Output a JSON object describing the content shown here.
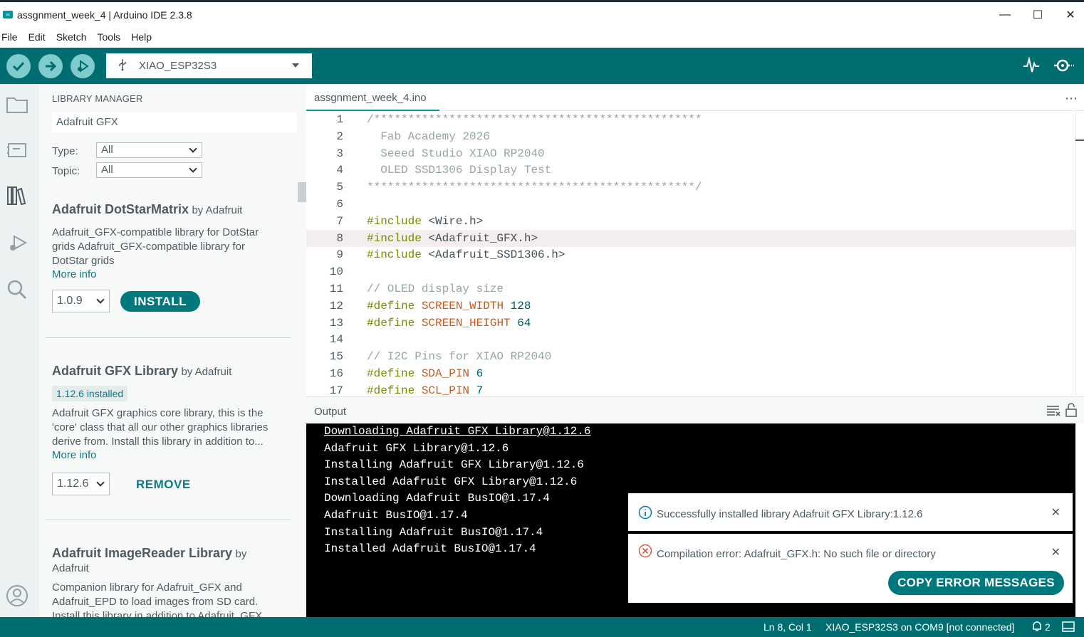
{
  "window": {
    "title": "assgnment_week_4 | Arduino IDE 2.3.8",
    "minimize": "—",
    "maximize": "☐",
    "close": "✕"
  },
  "menu": [
    "File",
    "Edit",
    "Sketch",
    "Tools",
    "Help"
  ],
  "toolbar": {
    "board": "XIAO_ESP32S3",
    "accent": "#006d70"
  },
  "library_manager": {
    "title": "LIBRARY MANAGER",
    "search_value": "Adafruit GFX",
    "type_label": "Type:",
    "type_value": "All",
    "topic_label": "Topic:",
    "topic_value": "All",
    "items": [
      {
        "name": "Adafruit DotStarMatrix",
        "by": "by Adafruit",
        "desc_lines": [
          "Adafruit_GFX-compatible library for DotStar",
          "grids Adafruit_GFX-compatible library for",
          "DotStar grids"
        ],
        "more_info": "More info",
        "version": "1.0.9",
        "action": "INSTALL"
      },
      {
        "name": "Adafruit GFX Library",
        "by": "by Adafruit",
        "installed": "1.12.6 installed",
        "desc_lines": [
          "Adafruit GFX graphics core library, this is the",
          "'core' class that all our other graphics libraries",
          "derive from. Install this library in addition to..."
        ],
        "more_info": "More info",
        "version": "1.12.6",
        "action": "REMOVE"
      },
      {
        "name": "Adafruit ImageReader Library",
        "by_inline": "by",
        "by_line2": "Adafruit",
        "desc_lines": [
          "Companion library for Adafruit_GFX and",
          "Adafruit_EPD to load images from SD card.",
          "Install this library in addition to Adafruit_GFX"
        ]
      }
    ]
  },
  "editor": {
    "tab": "assgnment_week_4.ino",
    "more": "⋯",
    "lines": [
      {
        "n": "1",
        "parts": [
          [
            "c-comment",
            "/************************************************"
          ]
        ]
      },
      {
        "n": "2",
        "parts": [
          [
            "c-comment",
            "  Fab Academy 2026"
          ]
        ]
      },
      {
        "n": "3",
        "parts": [
          [
            "c-comment",
            "  Seeed Studio XIAO RP2040"
          ]
        ]
      },
      {
        "n": "4",
        "parts": [
          [
            "c-comment",
            "  OLED SSD1306 Display Test"
          ]
        ]
      },
      {
        "n": "5",
        "parts": [
          [
            "c-comment",
            "************************************************/"
          ]
        ]
      },
      {
        "n": "6",
        "parts": []
      },
      {
        "n": "7",
        "parts": [
          [
            "c-kw",
            "#include"
          ],
          [
            "c-inc",
            " <Wire.h>"
          ]
        ]
      },
      {
        "n": "8",
        "parts": [
          [
            "c-kw",
            "#include"
          ],
          [
            "c-inc",
            " <Adafruit_GFX.h>"
          ]
        ],
        "active": true
      },
      {
        "n": "9",
        "parts": [
          [
            "c-kw",
            "#include"
          ],
          [
            "c-inc",
            " <Adafruit_SSD1306.h>"
          ]
        ]
      },
      {
        "n": "10",
        "parts": []
      },
      {
        "n": "11",
        "parts": [
          [
            "c-comment",
            "// OLED display size"
          ]
        ]
      },
      {
        "n": "12",
        "parts": [
          [
            "c-kw",
            "#define"
          ],
          [
            "c-def",
            " SCREEN_WIDTH"
          ],
          [
            "c-num",
            " 128"
          ]
        ]
      },
      {
        "n": "13",
        "parts": [
          [
            "c-kw",
            "#define"
          ],
          [
            "c-def",
            " SCREEN_HEIGHT"
          ],
          [
            "c-num",
            " 64"
          ]
        ]
      },
      {
        "n": "14",
        "parts": []
      },
      {
        "n": "15",
        "parts": [
          [
            "c-comment",
            "// I2C Pins for XIAO RP2040"
          ]
        ]
      },
      {
        "n": "16",
        "parts": [
          [
            "c-kw",
            "#define"
          ],
          [
            "c-def",
            " SDA_PIN"
          ],
          [
            "c-num",
            " 6"
          ]
        ]
      },
      {
        "n": "17",
        "parts": [
          [
            "c-kw",
            "#define"
          ],
          [
            "c-def",
            " SCL_PIN"
          ],
          [
            "c-num",
            " 7"
          ]
        ]
      }
    ]
  },
  "output": {
    "title": "Output",
    "lines": [
      "Downloading Adafruit GFX Library@1.12.6",
      "Adafruit GFX Library@1.12.6",
      "Installing Adafruit GFX Library@1.12.6",
      "Installed Adafruit GFX Library@1.12.6",
      "Downloading Adafruit BusIO@1.17.4",
      "Adafruit BusIO@1.17.4",
      "Installing Adafruit BusIO@1.17.4",
      "Installed Adafruit BusIO@1.17.4"
    ]
  },
  "notifications": {
    "info": "Successfully installed library Adafruit GFX Library:1.12.6",
    "error": "Compilation error: Adafruit_GFX.h: No such file or directory",
    "copy_button": "COPY ERROR MESSAGES",
    "close": "✕",
    "info_color": "#0277bd",
    "error_color": "#da5b4a"
  },
  "status": {
    "position": "Ln 8, Col 1",
    "board_port": "XIAO_ESP32S3 on COM9 [not connected]",
    "notif_count": "2"
  }
}
